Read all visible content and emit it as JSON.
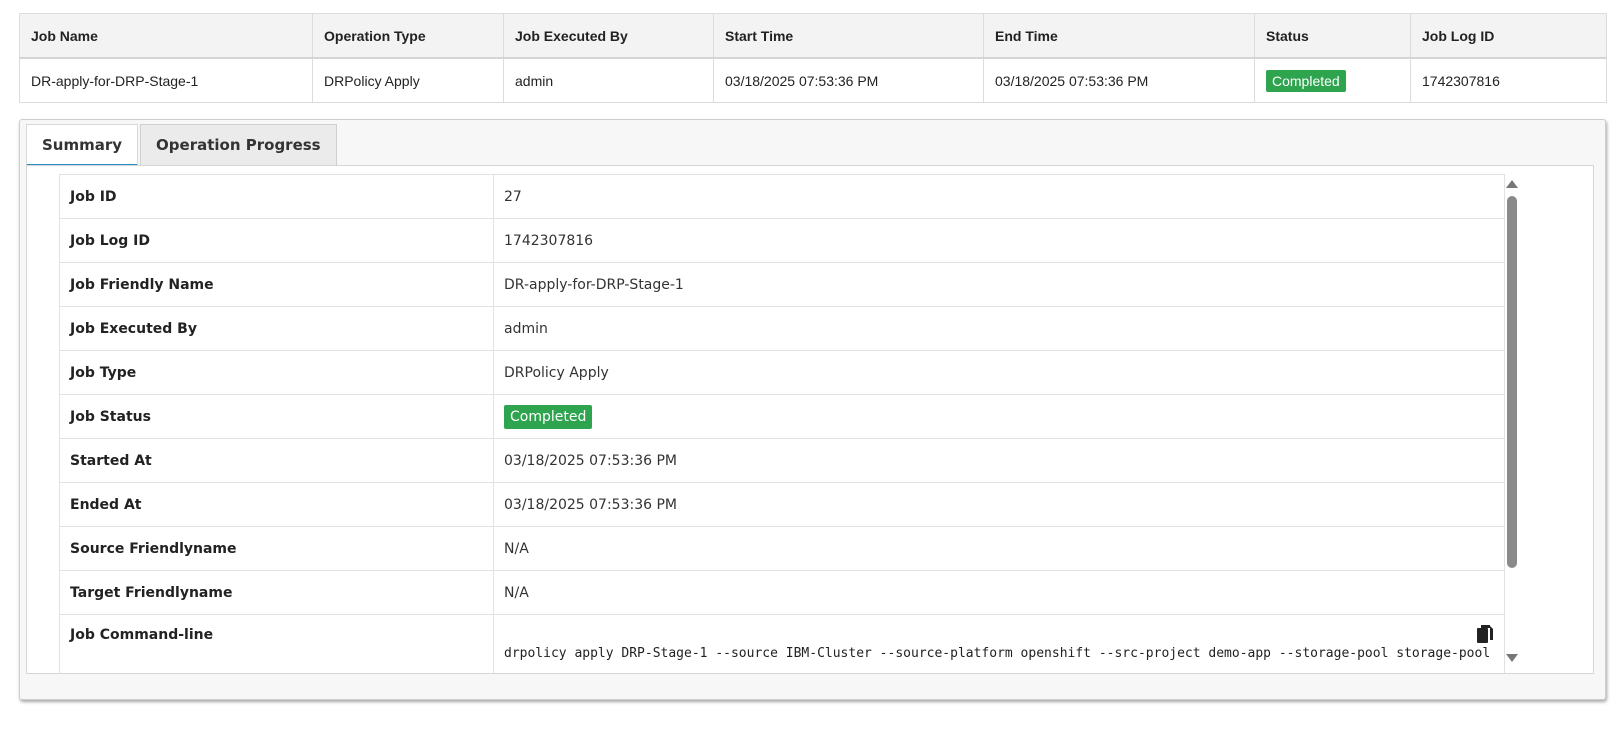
{
  "jobs_table": {
    "headers": [
      "Job Name",
      "Operation Type",
      "Job Executed By",
      "Start Time",
      "End Time",
      "Status",
      "Job Log ID"
    ],
    "row": {
      "job_name": "DR-apply-for-DRP-Stage-1",
      "operation_type": "DRPolicy Apply",
      "executed_by": "admin",
      "start_time": "03/18/2025 07:53:36 PM",
      "end_time": "03/18/2025 07:53:36 PM",
      "status": "Completed",
      "job_log_id": "1742307816"
    }
  },
  "tabs": [
    "Summary",
    "Operation Progress"
  ],
  "active_tab": "Summary",
  "summary": [
    {
      "label": "Job ID",
      "value": "27"
    },
    {
      "label": "Job Log ID",
      "value": "1742307816"
    },
    {
      "label": "Job Friendly Name",
      "value": "DR-apply-for-DRP-Stage-1"
    },
    {
      "label": "Job Executed By",
      "value": "admin"
    },
    {
      "label": "Job Type",
      "value": "DRPolicy Apply"
    },
    {
      "label": "Job Status",
      "value": "Completed"
    },
    {
      "label": "Started At",
      "value": "03/18/2025 07:53:36 PM"
    },
    {
      "label": "Ended At",
      "value": "03/18/2025 07:53:36 PM"
    },
    {
      "label": "Source Friendlyname",
      "value": "N/A"
    },
    {
      "label": "Target Friendlyname",
      "value": "N/A"
    },
    {
      "label": "Job Command-line",
      "value": "drpolicy apply DRP-Stage-1 --source IBM-Cluster --source-platform openshift --src-project demo-app --storage-pool storage-pool"
    }
  ],
  "icons": {
    "copy": "copy-icon",
    "scroll_up": "chevron-up-icon",
    "scroll_down": "chevron-down-icon"
  },
  "colors": {
    "status_completed": "#2ea44f",
    "active_tab_underline": "#2b8cc4"
  }
}
